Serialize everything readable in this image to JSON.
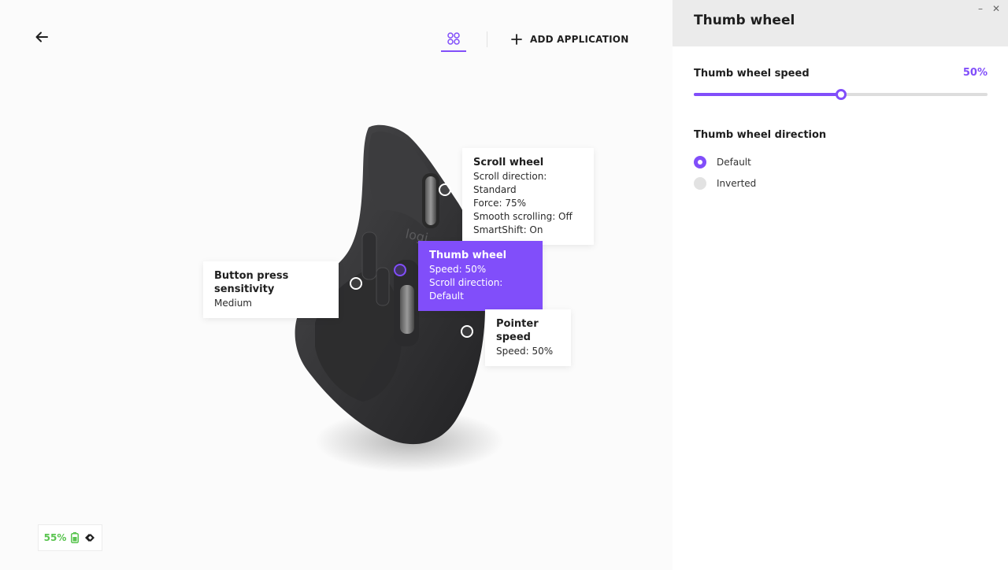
{
  "header": {
    "back_icon": "arrow-left-icon",
    "apps_icon": "four-circles-icon",
    "add_application_label": "ADD APPLICATION",
    "accent_color": "#814efa"
  },
  "callouts": {
    "scroll_wheel": {
      "title": "Scroll wheel",
      "lines": [
        "Scroll direction: Standard",
        "Force: 75%",
        "Smooth scrolling: Off",
        "SmartShift: On"
      ]
    },
    "thumb_wheel": {
      "title": "Thumb wheel",
      "lines": [
        "Speed: 50%",
        "Scroll direction: Default"
      ]
    },
    "button_press": {
      "title": "Button press sensitivity",
      "lines": [
        "Medium"
      ]
    },
    "pointer_speed": {
      "title": "Pointer speed",
      "lines": [
        "Speed: 50%"
      ]
    }
  },
  "device": {
    "battery_percent": "55%",
    "battery_icon": "battery-icon",
    "connection_icon": "logi-bolt-icon"
  },
  "panel": {
    "title": "Thumb wheel",
    "minimize_glyph": "–",
    "close_glyph": "✕",
    "speed_label": "Thumb wheel speed",
    "speed_value": "50%",
    "speed_fraction": 0.5,
    "direction_label": "Thumb wheel direction",
    "direction_options": [
      {
        "label": "Default",
        "selected": true
      },
      {
        "label": "Inverted",
        "selected": false
      }
    ]
  }
}
